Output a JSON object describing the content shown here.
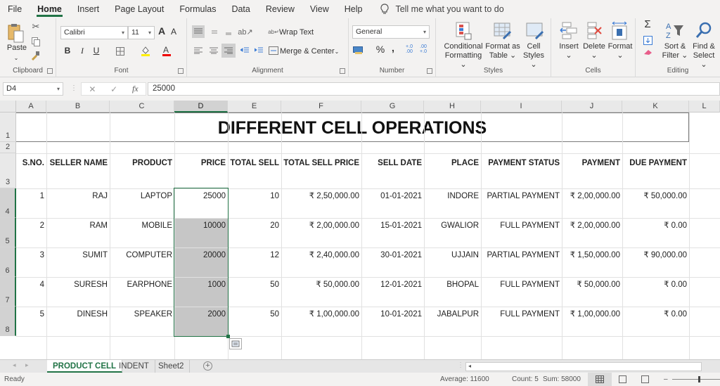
{
  "menu": {
    "tabs": [
      "File",
      "Home",
      "Insert",
      "Page Layout",
      "Formulas",
      "Data",
      "Review",
      "View",
      "Help"
    ],
    "active": "Home",
    "tell_me": "Tell me what you want to do"
  },
  "ribbon": {
    "clipboard": {
      "label": "Clipboard",
      "paste": "Paste"
    },
    "font": {
      "label": "Font",
      "font_name": "Calibri",
      "font_size": "11",
      "bold": "B",
      "italic": "I",
      "underline": "U",
      "grow": "A",
      "shrink": "A"
    },
    "alignment": {
      "label": "Alignment",
      "wrap_text": "Wrap Text",
      "merge_center": "Merge & Center"
    },
    "number": {
      "label": "Number",
      "format": "General",
      "percent": "%",
      "comma": ",",
      "inc_decimal": "+.0 .00",
      "dec_decimal": ".00 +.0"
    },
    "styles": {
      "label": "Styles",
      "conditional_1": "Conditional",
      "conditional_2": "Formatting",
      "format_table_1": "Format as",
      "format_table_2": "Table",
      "cell_styles_1": "Cell",
      "cell_styles_2": "Styles"
    },
    "cells": {
      "label": "Cells",
      "insert": "Insert",
      "delete": "Delete",
      "format": "Format"
    },
    "editing": {
      "label": "Editing",
      "sort_1": "Sort &",
      "sort_2": "Filter",
      "find_1": "Find &",
      "find_2": "Select",
      "sigma": "Σ"
    }
  },
  "formula_bar": {
    "name_box": "D4",
    "fx": "fx",
    "value": "25000"
  },
  "sheet": {
    "columns": [
      "A",
      "B",
      "C",
      "D",
      "E",
      "F",
      "G",
      "H",
      "I",
      "J",
      "K",
      "L"
    ],
    "rows": [
      "1",
      "2",
      "3",
      "4",
      "5",
      "6",
      "7",
      "8"
    ],
    "title": "DIFFERENT CELL OPERATIONS",
    "headers": [
      "S.NO.",
      "SELLER NAME",
      "PRODUCT",
      "PRICE",
      "TOTAL SELL",
      "TOTAL SELL PRICE",
      "SELL DATE",
      "PLACE",
      "PAYMENT STATUS",
      "PAYMENT",
      "DUE PAYMENT"
    ],
    "data": [
      [
        "1",
        "RAJ",
        "LAPTOP",
        "25000",
        "10",
        "₹ 2,50,000.00",
        "01-01-2021",
        "INDORE",
        "PARTIAL PAYMENT",
        "₹ 2,00,000.00",
        "₹ 50,000.00"
      ],
      [
        "2",
        "RAM",
        "MOBILE",
        "10000",
        "20",
        "₹ 2,00,000.00",
        "15-01-2021",
        "GWALIOR",
        "FULL PAYMENT",
        "₹ 2,00,000.00",
        "₹ 0.00"
      ],
      [
        "3",
        "SUMIT",
        "COMPUTER",
        "20000",
        "12",
        "₹ 2,40,000.00",
        "30-01-2021",
        "UJJAIN",
        "PARTIAL PAYMENT",
        "₹ 1,50,000.00",
        "₹ 90,000.00"
      ],
      [
        "4",
        "SURESH",
        "EARPHONE",
        "1000",
        "50",
        "₹ 50,000.00",
        "12-01-2021",
        "BHOPAL",
        "FULL PAYMENT",
        "₹ 50,000.00",
        "₹ 0.00"
      ],
      [
        "5",
        "DINESH",
        "SPEAKER",
        "2000",
        "50",
        "₹ 1,00,000.00",
        "10-01-2021",
        "JABALPUR",
        "FULL PAYMENT",
        "₹ 1,00,000.00",
        "₹ 0.00"
      ]
    ],
    "selected_cell": "D4",
    "selected_range": "D4:D8"
  },
  "sheet_tabs": {
    "tabs": [
      "PRODUCT CELL",
      "INDENT",
      "Sheet2"
    ],
    "active": "PRODUCT CELL",
    "add": "+"
  },
  "status": {
    "ready": "Ready",
    "average": "Average: 11600",
    "count": "Count: 5",
    "sum": "Sum: 58000"
  },
  "colors": {
    "accent": "#217346",
    "selection": "#c6c6c6"
  }
}
